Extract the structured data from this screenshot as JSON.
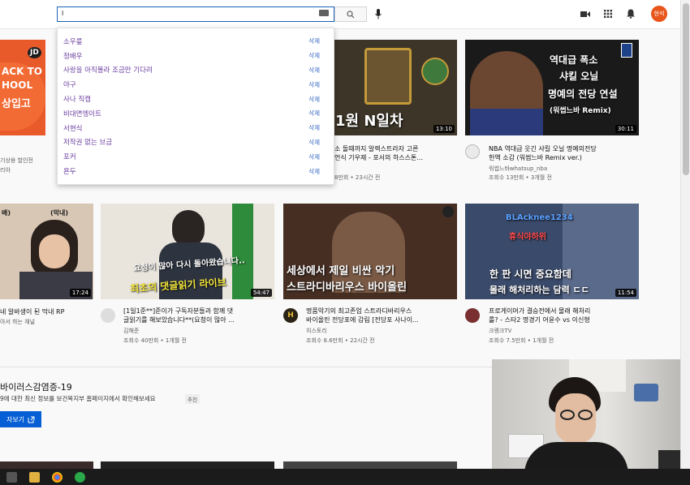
{
  "search": {
    "value": "l"
  },
  "header": {
    "avatar_text": "현석"
  },
  "suggestions": [
    {
      "text": "소우릎",
      "delete": "삭제"
    },
    {
      "text": "정배우",
      "delete": "삭제"
    },
    {
      "text": "사랑을 아직몰라 조금만 기다려",
      "delete": "삭제"
    },
    {
      "text": "야구",
      "delete": "삭제"
    },
    {
      "text": "사나 직캠",
      "delete": "삭제"
    },
    {
      "text": "비대면엥이트",
      "delete": "삭제"
    },
    {
      "text": "서현식",
      "delete": "삭제"
    },
    {
      "text": "저작권 없는 브금",
      "delete": "삭제"
    },
    {
      "text": "포커",
      "delete": "삭제"
    },
    {
      "text": "욘두",
      "delete": "삭제"
    }
  ],
  "row1": [
    {
      "overlay": [
        "JD",
        "ACK TO",
        "HOOL",
        "상입고"
      ],
      "title": "",
      "channel": "기상용 할인전",
      "stats": "리아",
      "duration": ""
    },
    {
      "overlay": [
        "1원 N일차"
      ],
      "title": [
        "소 돌때까지 알렉스트라자 고른",
        "언식 기우제 - 포서의 하스스톤..."
      ],
      "channel": "",
      "stats": "8만회 • 23시간 전",
      "duration": "13:10"
    },
    {
      "overlay": [
        "역대급 폭소",
        "샤킬 오닐",
        "명예의 전당 연설",
        "(워썹느바 Remix)"
      ],
      "title": [
        "NBA 역대급 웃긴 샤킬 오닐 명예의전당",
        "헌액 소감 (워썹느바 Remix ver.)"
      ],
      "channel": "워썹느바whatsup_nba",
      "stats": "조회수 13만회 • 3개월 전",
      "duration": "30:11"
    }
  ],
  "row2": [
    {
      "overlay": [
        "배)",
        "(막내)"
      ],
      "title": [
        "네 알바생이 된 막내 RP"
      ],
      "channel": "아서 하는 채널",
      "stats": "",
      "duration": "17:24"
    },
    {
      "overlay": [
        "요청이 많아 다시 돌아왔습니다..",
        "최초의 댓글읽기 라이브"
      ],
      "title": [
        "[1일1준**]준이가 구독자분들과 함께 댓",
        "글읽기를 해보았습니다**(요청이 많아 ..."
      ],
      "channel": "김해준",
      "stats": "조회수 40만회 • 1개월 전",
      "duration": "54:47"
    },
    {
      "overlay": [
        "세상에서 제일 비싼 악기",
        "스트라디바리우스 바이올린"
      ],
      "title": [
        "명품악기의 최고존엄 스트라디바리우스",
        "바이올린 전당포에 감림 [전당포 사나이..."
      ],
      "channel": "히스토리",
      "stats": "조회수 8.6만회 • 22시간 전",
      "duration": ""
    },
    {
      "overlay": [
        "BLAcknee1234",
        "휴식야하위",
        "한 판 시면 중요함데",
        "몰래 해처리하는 담력 ㄷㄷ"
      ],
      "title": [
        "프로게이머가 결승전에서 몰래 해처리",
        "룰? - 스타2 명경기 어윤수 vs 이신형"
      ],
      "channel": "크랭크TV",
      "stats": "조회수 7.5만회 • 1개월 전",
      "duration": "11:54"
    }
  ],
  "section": {
    "title": "바이러스감염증-19",
    "desc": "9에 대한 최신 정보를 보건복지부 홈페이지에서 확인해보세요",
    "tag": "추천",
    "button": "자보기"
  },
  "colors": {
    "accent": "#065fd4",
    "suggestion": "#6b3fa0",
    "delete_link": "#3a6bc5"
  }
}
